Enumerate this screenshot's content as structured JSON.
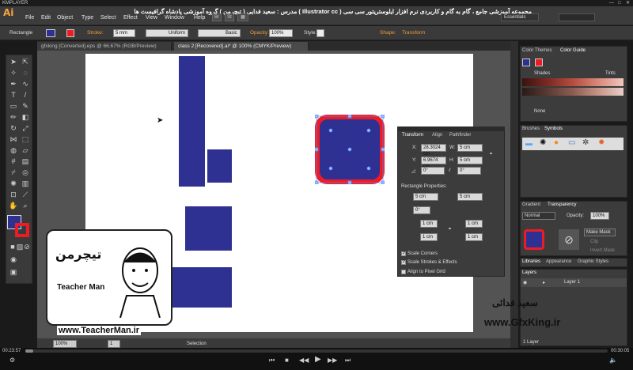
{
  "player": {
    "brand": "KMPLAYER",
    "time_elapsed": "00:23:57",
    "time_total": "00:30:05"
  },
  "app": {
    "logo": "Ai",
    "course_title": "مجموعه آموزشی جامع ، گام به گام و کاربردی نرم افزار ایلوستریتور سی سی ( Illustrator cc )  مدرس : سعید فدایی ( تیچرمن ) گروه آموزشی پادشاه گرافیست ها"
  },
  "menu": [
    "File",
    "Edit",
    "Object",
    "Type",
    "Select",
    "Effect",
    "View",
    "Window",
    "Help"
  ],
  "toolbar_buttons": [
    "Br",
    "St"
  ],
  "workspace": "Essentials",
  "control": {
    "object_type": "Rectangle",
    "stroke_label": "Stroke:",
    "stroke_value": "5 mm",
    "profile": "Uniform",
    "brush": "Basic",
    "opacity_label": "Opacity:",
    "opacity_value": "100%",
    "style_label": "Style:",
    "shape_label": "Shape:",
    "transform_label": "Transform"
  },
  "documents": [
    {
      "label": "gfxking [Converted].eps @ 66.67% (RGB/Preview)",
      "active": false
    },
    {
      "label": "class 2 [Recovered].ai* @ 100% (CMYK/Preview)",
      "active": true
    }
  ],
  "transform_panel": {
    "tabs": [
      "Transform",
      "Align",
      "Pathfinder"
    ],
    "x_label": "X:",
    "x": "28.3024 cm",
    "y_label": "Y:",
    "y": "6.9674 cm",
    "w_label": "W:",
    "w": "5 cm",
    "h_label": "H:",
    "h": "5 cm",
    "angle": "0°",
    "shear": "0°",
    "rect_props": "Rectangle Properties:",
    "rect_w": "5 cm",
    "rect_h": "5 cm",
    "rect_angle": "0°",
    "corners": [
      "1 cm",
      "1 cm",
      "1 cm",
      "1 cm"
    ],
    "scale_corners": "Scale Corners",
    "scale_strokes": "Scale Strokes & Effects",
    "align_pixel": "Align to Pixel Grid"
  },
  "color_panel": {
    "tabs": [
      "Color Themes",
      "Color Guide"
    ],
    "shades": "Shades",
    "tints": "Tints",
    "none": "None"
  },
  "brushes_panel": {
    "tabs": [
      "Brushes",
      "Symbols"
    ]
  },
  "gradient_panel": {
    "tabs": [
      "Gradient",
      "Transparency"
    ],
    "blend": "Normal",
    "opacity_label": "Opacity:",
    "opacity": "100%",
    "make_mask": "Make Mask",
    "clip": "Clip",
    "invert": "Invert Mask"
  },
  "libraries_panel": {
    "tabs": [
      "Libraries",
      "Appearance",
      "Graphic Styles"
    ]
  },
  "layers_panel": {
    "title": "Layers",
    "layer": "Layer 1",
    "count": "1 Layer"
  },
  "status": {
    "zoom": "100%",
    "page": "1",
    "tool": "Selection"
  },
  "overlay": {
    "teacher_brand": "تیچرمن",
    "teacher_sub": "Teacher Man",
    "site1": "www.TeacherMan.ir",
    "site2": "www.GfxKing.ir",
    "name_fa": "سعید فدائی"
  },
  "colors": {
    "fill": "#2e3192",
    "stroke": "#ed1c24"
  }
}
